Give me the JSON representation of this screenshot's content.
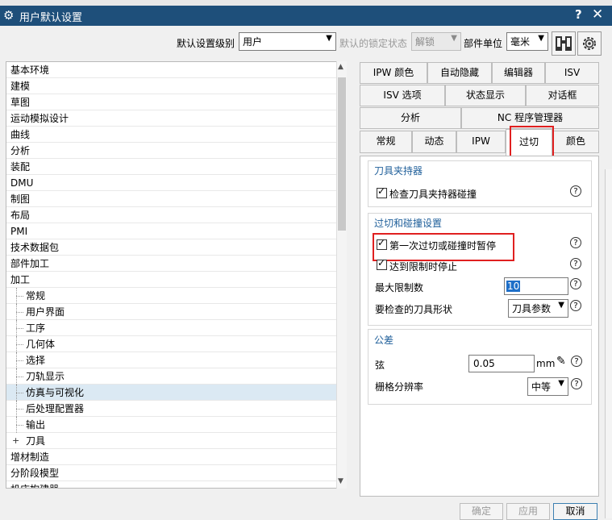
{
  "window": {
    "title": "用户默认设置",
    "help": "?",
    "close": "✕"
  },
  "toolbar": {
    "level_label": "默认设置级别",
    "level_value": "用户",
    "lock_label": "默认的锁定状态",
    "lock_value": "解锁",
    "unit_label": "部件单位",
    "unit_value": "毫米"
  },
  "tree": {
    "items": [
      {
        "label": "基本环境"
      },
      {
        "label": "建模"
      },
      {
        "label": "草图"
      },
      {
        "label": "运动模拟设计"
      },
      {
        "label": "曲线"
      },
      {
        "label": "分析"
      },
      {
        "label": "装配"
      },
      {
        "label": "DMU"
      },
      {
        "label": "制图"
      },
      {
        "label": "布局"
      },
      {
        "label": "PMI"
      },
      {
        "label": "技术数据包"
      },
      {
        "label": "部件加工"
      },
      {
        "label": "加工"
      },
      {
        "label": "常规"
      },
      {
        "label": "用户界面"
      },
      {
        "label": "工序"
      },
      {
        "label": "几何体"
      },
      {
        "label": "选择"
      },
      {
        "label": "刀轨显示"
      },
      {
        "label": "仿真与可视化"
      },
      {
        "label": "后处理配置器"
      },
      {
        "label": "输出"
      },
      {
        "label": "刀具"
      },
      {
        "label": "增材制造"
      },
      {
        "label": "分阶段模型"
      },
      {
        "label": "机床构建器"
      }
    ]
  },
  "tabs": {
    "row1": [
      "IPW 颜色",
      "自动隐藏",
      "编辑器",
      "ISV"
    ],
    "row2": [
      "ISV 选项",
      "状态显示",
      "对话框"
    ],
    "row3": [
      "分析",
      "NC 程序管理器"
    ],
    "row4": [
      "常规",
      "动态",
      "IPW",
      "过切",
      "颜色"
    ]
  },
  "panel": {
    "holder_group": "刀具夹持器",
    "check_holder": "检查刀具夹持器碰撞",
    "gouge_group": "过切和碰撞设置",
    "pause_first": "第一次过切或碰撞时暂停",
    "stop_limit": "达到限制时停止",
    "max_limit_label": "最大限制数",
    "max_limit_value": "10",
    "shape_label": "要检查的刀具形状",
    "shape_value": "刀具参数",
    "tol_group": "公差",
    "chord_label": "弦",
    "chord_value": "0.05",
    "chord_unit": "mm",
    "grid_label": "栅格分辨率",
    "grid_value": "中等"
  },
  "footer": {
    "ok": "确定",
    "apply": "应用",
    "cancel": "取消"
  },
  "colors": {
    "title_bar": "#1e4f7a",
    "highlight": "#e02020",
    "group_title": "#1f5f9a"
  }
}
